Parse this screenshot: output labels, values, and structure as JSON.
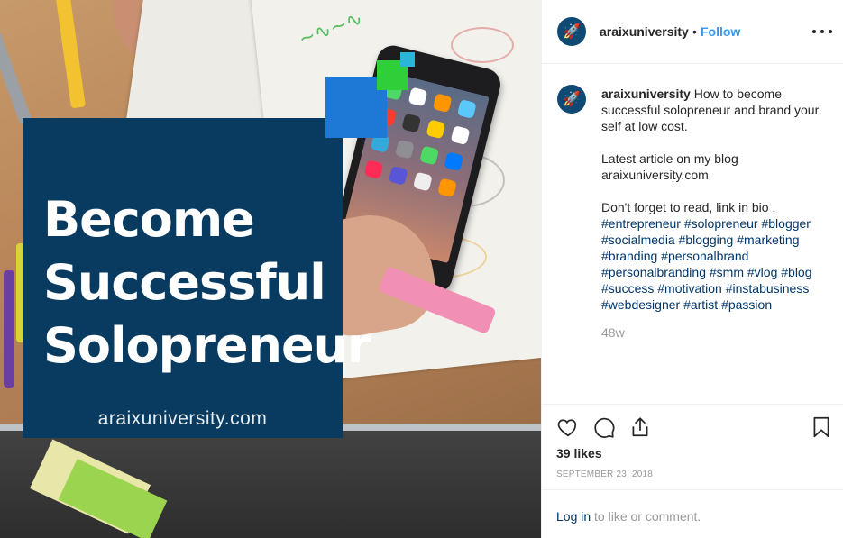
{
  "post_image": {
    "title_lines": [
      "Become",
      "Successful",
      "Solopreneur"
    ],
    "site": "araixuniversity.com",
    "colors": {
      "banner": "#093a5f",
      "blue_square": "#1e79d6",
      "green_square": "#2fcf3a",
      "cyan_square": "#2ab6d8"
    }
  },
  "header": {
    "username": "araixuniversity",
    "separator": "•",
    "follow_label": "Follow",
    "avatar_icon": "rocket-icon",
    "more_icon": "more-options-icon"
  },
  "caption": {
    "username": "araixuniversity",
    "text_1": "How to become successful solopreneur and brand your self at low cost.",
    "text_2": "Latest article on my blog araixuniversity.com",
    "text_3": "Don't forget to read, link in bio .",
    "hashtags": [
      "#entrepreneur",
      "#solopreneur",
      "#blogger",
      "#socialmedia",
      "#blogging",
      "#marketing",
      "#branding",
      "#personalbrand",
      "#personalbranding",
      "#smm",
      "#vlog",
      "#blog",
      "#success",
      "#motivation",
      "#instabusiness",
      "#webdesigner",
      "#artist",
      "#passion"
    ],
    "age": "48w"
  },
  "actions": {
    "like_icon": "heart-icon",
    "comment_icon": "comment-icon",
    "share_icon": "share-icon",
    "save_icon": "bookmark-icon",
    "likes": "39 likes",
    "date": "SEPTEMBER 23, 2018"
  },
  "footer": {
    "login_link": "Log in",
    "login_text": " to like or comment."
  },
  "colors": {
    "link": "#3897f0",
    "hashtag": "#003569",
    "muted": "#999999",
    "text": "#262626"
  }
}
